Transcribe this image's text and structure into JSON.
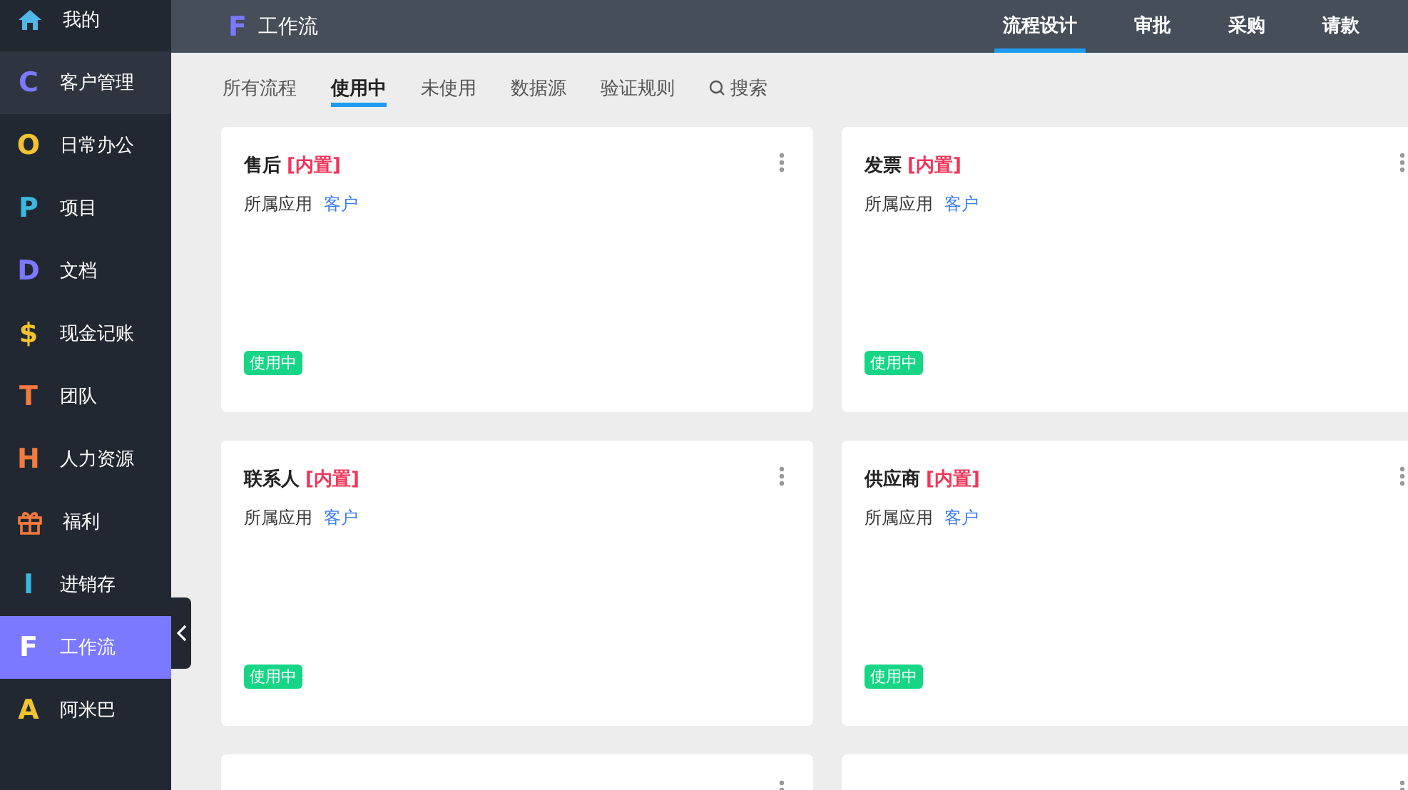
{
  "sidebar": {
    "items": [
      {
        "label": "我的",
        "kind": "home",
        "color": "#4fb8e8",
        "selected": false,
        "hovered": false
      },
      {
        "label": "客户管理",
        "kind": "letter",
        "glyph": "C",
        "color": "#7b79ff",
        "selected": false,
        "hovered": true
      },
      {
        "label": "日常办公",
        "kind": "letter",
        "glyph": "O",
        "color": "#f2c330",
        "selected": false,
        "hovered": false
      },
      {
        "label": "项目",
        "kind": "letter",
        "glyph": "P",
        "color": "#3cb8e0",
        "selected": false,
        "hovered": false
      },
      {
        "label": "文档",
        "kind": "letter",
        "glyph": "D",
        "color": "#7b79ff",
        "selected": false,
        "hovered": false
      },
      {
        "label": "现金记账",
        "kind": "letter",
        "glyph": "$",
        "color": "#f2c330",
        "selected": false,
        "hovered": false
      },
      {
        "label": "团队",
        "kind": "letter",
        "glyph": "T",
        "color": "#f57a3d",
        "selected": false,
        "hovered": false
      },
      {
        "label": "人力资源",
        "kind": "letter",
        "glyph": "H",
        "color": "#f57a3d",
        "selected": false,
        "hovered": false
      },
      {
        "label": "福利",
        "kind": "gift",
        "color": "#f57a3d",
        "selected": false,
        "hovered": false
      },
      {
        "label": "进销存",
        "kind": "letter",
        "glyph": "I",
        "color": "#3cb8e0",
        "selected": false,
        "hovered": false
      },
      {
        "label": "工作流",
        "kind": "letter",
        "glyph": "F",
        "color": "#ffffff",
        "selected": true,
        "hovered": false
      },
      {
        "label": "阿米巴",
        "kind": "letter",
        "glyph": "A",
        "color": "#f2c330",
        "selected": false,
        "hovered": false
      }
    ]
  },
  "header": {
    "logo": "F",
    "title": "工作流",
    "nav": [
      {
        "label": "流程设计",
        "selected": true
      },
      {
        "label": "审批",
        "selected": false
      },
      {
        "label": "采购",
        "selected": false
      },
      {
        "label": "请款",
        "selected": false
      }
    ]
  },
  "tabs": [
    {
      "label": "所有流程",
      "selected": false
    },
    {
      "label": "使用中",
      "selected": true
    },
    {
      "label": "未使用",
      "selected": false
    },
    {
      "label": "数据源",
      "selected": false
    },
    {
      "label": "验证规则",
      "selected": false
    }
  ],
  "search": {
    "label": "搜索"
  },
  "cards": [
    {
      "kind": "full",
      "title": "售后",
      "tag": "[内置]",
      "app_label": "所属应用",
      "app": "客户",
      "status": "使用中"
    },
    {
      "kind": "full",
      "title": "发票",
      "tag": "[内置]",
      "app_label": "所属应用",
      "app": "客户",
      "status": "使用中"
    },
    {
      "kind": "full",
      "title": "联系人",
      "tag": "[内置]",
      "app_label": "所属应用",
      "app": "客户",
      "status": "使用中"
    },
    {
      "kind": "full",
      "title": "供应商",
      "tag": "[内置]",
      "app_label": "所属应用",
      "app": "客户",
      "status": "使用中"
    },
    {
      "kind": "cut"
    },
    {
      "kind": "cut"
    }
  ]
}
